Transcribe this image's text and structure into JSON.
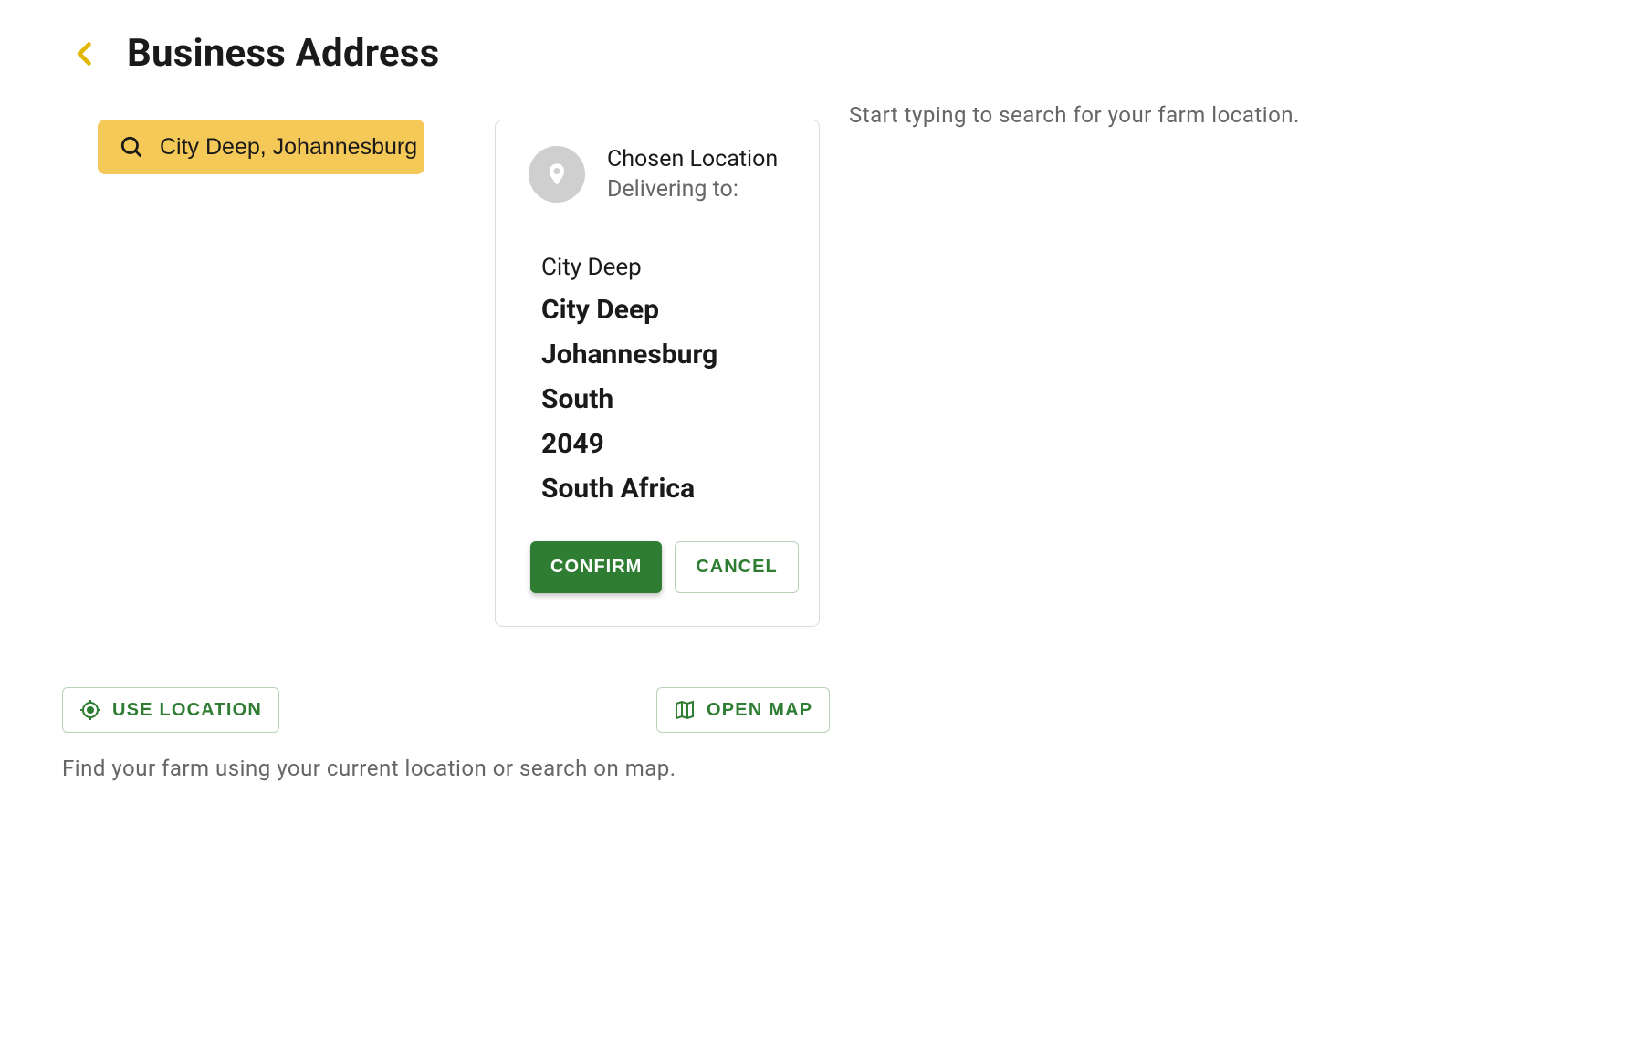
{
  "header": {
    "title": "Business Address"
  },
  "hint": "Start typing to search for your farm location.",
  "search": {
    "value": "City Deep, Johannesburg"
  },
  "card": {
    "heading": "Chosen Location",
    "subheading": "Delivering to:",
    "address": {
      "line1_small": "City Deep",
      "line2": "City Deep",
      "line3": "Johannesburg",
      "line4": "South",
      "line5": "2049",
      "line6": "South Africa"
    },
    "confirm_label": "CONFIRM",
    "cancel_label": "CANCEL"
  },
  "actions": {
    "use_location_label": "USE LOCATION",
    "open_map_label": "OPEN MAP"
  },
  "footer": "Find your farm using your current location or search on map."
}
